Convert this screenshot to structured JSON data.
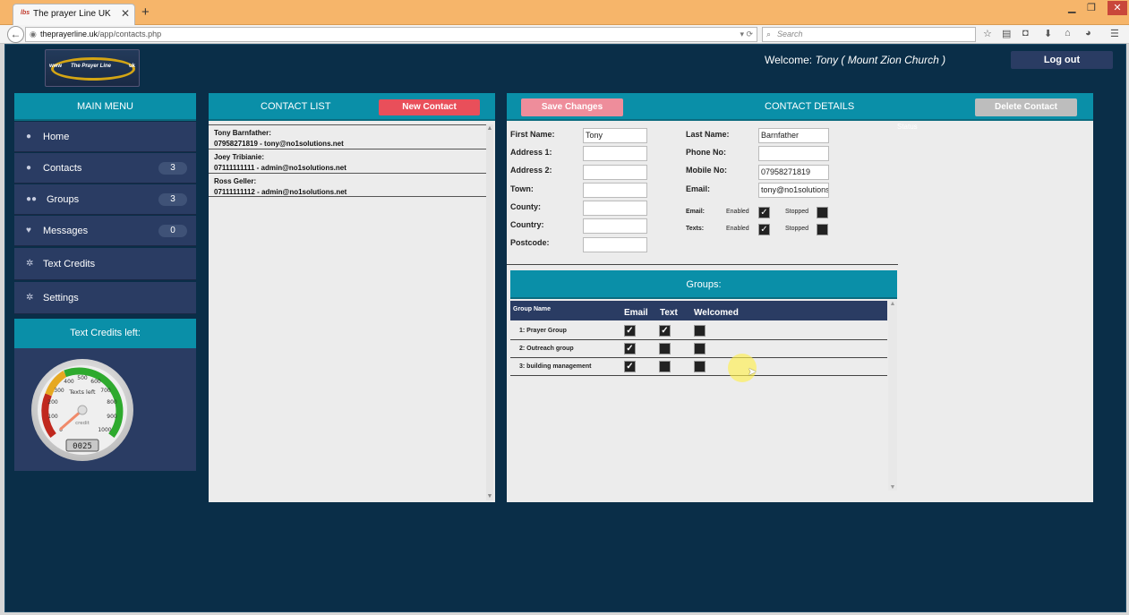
{
  "browser": {
    "tab_title": "The prayer Line UK",
    "tab_favicon": "lbs",
    "new_tab": "+",
    "url_host": "theprayerline.uk",
    "url_path": "/app/contacts.php",
    "search_placeholder": "Search"
  },
  "header": {
    "welcome_label": "Welcome:",
    "welcome_user": "Tony ( Mount Zion Church )",
    "logout_label": "Log out",
    "logo": {
      "www": "www",
      "name": "The Prayer Line",
      "uk": "uk"
    }
  },
  "menu": {
    "title": "MAIN MENU",
    "items": [
      {
        "label": "Home",
        "icon": "user-icon"
      },
      {
        "label": "Contacts",
        "icon": "user-icon",
        "count": "3"
      },
      {
        "label": "Groups",
        "icon": "users-icon",
        "count": "3"
      },
      {
        "label": "Messages",
        "icon": "heart-icon",
        "count": "0"
      },
      {
        "label": "Text Credits",
        "icon": "gear-icon"
      },
      {
        "label": "Settings",
        "icon": "gear-icon"
      }
    ]
  },
  "credits": {
    "title": "Text Credits left:",
    "gauge_label": "Texts left",
    "gauge_sublabel": "credit",
    "value": "0025",
    "ticks": [
      "0",
      "100",
      "200",
      "300",
      "400",
      "500",
      "600",
      "700",
      "800",
      "900",
      "1000"
    ]
  },
  "contact_list": {
    "title": "CONTACT LIST",
    "new_button": "New Contact",
    "contacts": [
      {
        "name": "Tony Barnfather:",
        "detail": "07958271819 - tony@no1solutions.net"
      },
      {
        "name": "Joey Tribianie:",
        "detail": "07111111111 - admin@no1solutions.net"
      },
      {
        "name": "Ross Geller:",
        "detail": "07111111112 - admin@no1solutions.net"
      }
    ]
  },
  "details": {
    "title": "CONTACT DETAILS",
    "save_button": "Save Changes",
    "delete_button": "Delete Contact",
    "status_label": "Status",
    "left_fields": [
      {
        "label": "First Name:",
        "value": "Tony"
      },
      {
        "label": "Address 1:",
        "value": ""
      },
      {
        "label": "Address 2:",
        "value": ""
      },
      {
        "label": "Town:",
        "value": ""
      },
      {
        "label": "County:",
        "value": ""
      },
      {
        "label": "Country:",
        "value": ""
      },
      {
        "label": "Postcode:",
        "value": ""
      }
    ],
    "right_fields": [
      {
        "label": "Last Name:",
        "value": "Barnfather"
      },
      {
        "label": "Phone No:",
        "value": ""
      },
      {
        "label": "Mobile No:",
        "value": "07958271819"
      },
      {
        "label": "Email:",
        "value": "tony@no1solutions.net"
      }
    ],
    "prefs": [
      {
        "label": "Email:",
        "enabled_label": "Enabled",
        "stopped_label": "Stopped",
        "enabled": true,
        "stopped": false
      },
      {
        "label": "Texts:",
        "enabled_label": "Enabled",
        "stopped_label": "Stopped",
        "enabled": true,
        "stopped": false
      }
    ]
  },
  "groups": {
    "title": "Groups:",
    "columns": [
      "Group Name",
      "Email",
      "Text",
      "Welcomed"
    ],
    "rows": [
      {
        "name": "1: Prayer Group",
        "email": true,
        "text": true,
        "welcomed": false
      },
      {
        "name": "2: Outreach group",
        "email": true,
        "text": false,
        "welcomed": false
      },
      {
        "name": "3: building management",
        "email": true,
        "text": false,
        "welcomed": false
      }
    ]
  },
  "colors": {
    "background": "#0a2e48",
    "panel_header": "#0a8fa8",
    "menu_item": "#2a3c63",
    "new_button": "#e94f5a",
    "save_button": "#ee8d9b",
    "delete_button": "#bdbdbd"
  }
}
